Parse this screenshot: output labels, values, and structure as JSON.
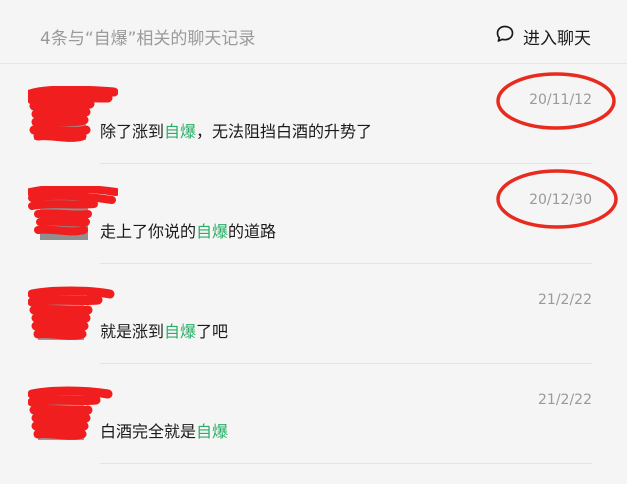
{
  "header": {
    "title": "4条与“自爆”相关的聊天记录",
    "enter_label": "进入聊天"
  },
  "records": [
    {
      "before": "除了涨到",
      "keyword": "自爆",
      "after": "，无法阻挡白酒的升势了",
      "date": "20/11/12"
    },
    {
      "before": "走上了你说的",
      "keyword": "自爆",
      "after": "的道路",
      "date": "20/12/30"
    },
    {
      "before": "就是涨到",
      "keyword": "自爆",
      "after": "了吧",
      "date": "21/2/22"
    },
    {
      "before": "白酒完全就是",
      "keyword": "自爆",
      "after": "",
      "date": "21/2/22"
    }
  ],
  "colors": {
    "keyword": "#2aae67",
    "annotation": "#e82a1f",
    "redaction": "#f01e1e"
  },
  "icons": {
    "enter_chat": "chat-bubble-icon"
  }
}
